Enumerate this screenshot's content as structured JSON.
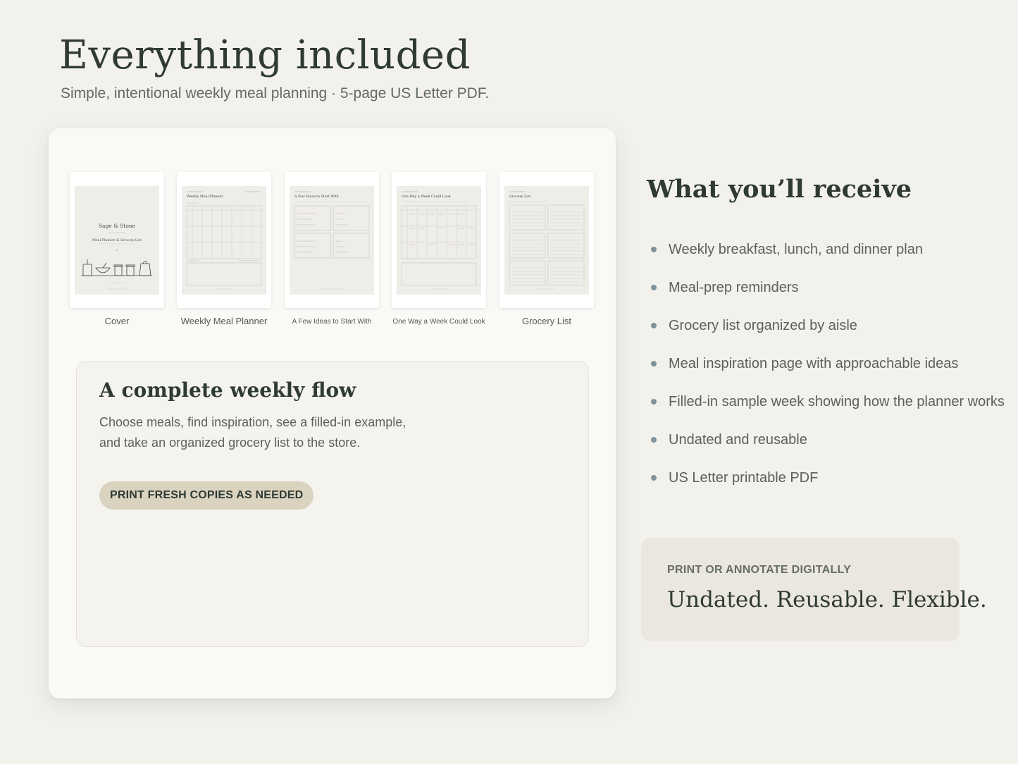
{
  "header": {
    "title": "Everything included",
    "subtitle": "Simple, intentional weekly meal planning · 5-page US Letter PDF."
  },
  "preview": {
    "pages": [
      {
        "label": "Cover",
        "cover_title": "Sage & Stone",
        "cover_subtitle": "Meal Planner & Grocery List"
      },
      {
        "label": "Weekly Meal Planner",
        "heading": "Weekly Meal Planner"
      },
      {
        "label": "A Few Ideas to Start With",
        "heading": "A Few Ideas to Start With"
      },
      {
        "label": "One Way a Week Could Look",
        "heading": "One Way a Week Could Look"
      },
      {
        "label": "Grocery List",
        "heading": "Grocery List"
      }
    ]
  },
  "flow": {
    "title": "A complete weekly flow",
    "text_line1": "Choose meals, find inspiration, see a filled-in example,",
    "text_line2": "and take an organized grocery list to the store.",
    "pill_label": "PRINT FRESH COPIES AS NEEDED"
  },
  "receive": {
    "title": "What you’ll receive",
    "items": [
      "Weekly breakfast, lunch, and dinner plan",
      "Meal-prep reminders",
      "Grocery list organized by aisle",
      "Meal inspiration page with approachable ideas",
      "Filled-in sample week showing how the planner works",
      "Undated and reusable",
      "US Letter printable PDF"
    ]
  },
  "callout": {
    "kicker": "PRINT OR ANNOTATE DIGITALLY",
    "headline": "Undated. Reusable. Flexible."
  },
  "colors": {
    "background": "#f2f1ec",
    "card": "#faf9f5",
    "text": "#2f3a33",
    "muted": "#5b615c",
    "pill": "#d9d3c0",
    "bullet": "#7f939c",
    "callout": "#e9e7df"
  }
}
